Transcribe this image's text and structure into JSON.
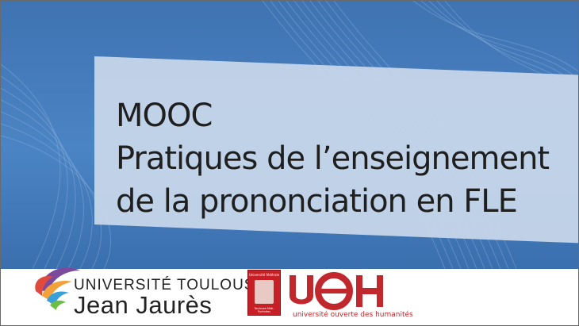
{
  "banner": {
    "title_lines": [
      "MOOC",
      "Pratiques de l’enseignement",
      "de la prononciation en FLE"
    ]
  },
  "logos": {
    "university": {
      "line1": "UNIVERSITÉ TOULOUSE",
      "line2": "Jean Jaurès",
      "icon": "ut-flower-logo-icon"
    },
    "seal": {
      "top": "Université fédérale",
      "bottom": "Toulouse Midi-Pyrénées",
      "color": "#c62026"
    },
    "uoh": {
      "letters": "UOH",
      "subtitle": "université ouverte des humanités",
      "color": "#c0282d"
    }
  },
  "colors": {
    "banner": "#4b84c4",
    "title_band": "#cddaec",
    "title_text": "#1f1f1f"
  }
}
